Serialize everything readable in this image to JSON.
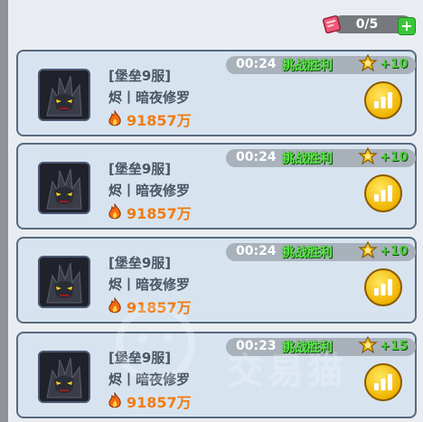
{
  "header": {
    "ticket_count": "0/5",
    "plus_label": "+"
  },
  "cards": [
    {
      "server": "[堡垒9服]",
      "player": "烬丨暗夜修罗",
      "power": "91857万",
      "time": "00:24",
      "status": "挑战胜利",
      "points": "+10"
    },
    {
      "server": "[堡垒9服]",
      "player": "烬丨暗夜修罗",
      "power": "91857万",
      "time": "00:24",
      "status": "挑战胜利",
      "points": "+10"
    },
    {
      "server": "[堡垒9服]",
      "player": "烬丨暗夜修罗",
      "power": "91857万",
      "time": "00:24",
      "status": "挑战胜利",
      "points": "+10"
    },
    {
      "server": "[堡垒9服]",
      "player": "烬丨暗夜修罗",
      "power": "91857万",
      "time": "00:23",
      "status": "挑战胜利",
      "points": "+15"
    }
  ],
  "watermark": "交易猫",
  "colors": {
    "card_bg": "#d7e4f0",
    "card_border": "#586a80",
    "win_text": "#5fe84a",
    "power_text": "#f07b12",
    "rank_button": "#f0b400"
  },
  "icons": [
    "ticket-icon",
    "plus-icon",
    "avatar-portrait",
    "fire-icon",
    "medal-icon",
    "rank-bars-icon"
  ]
}
